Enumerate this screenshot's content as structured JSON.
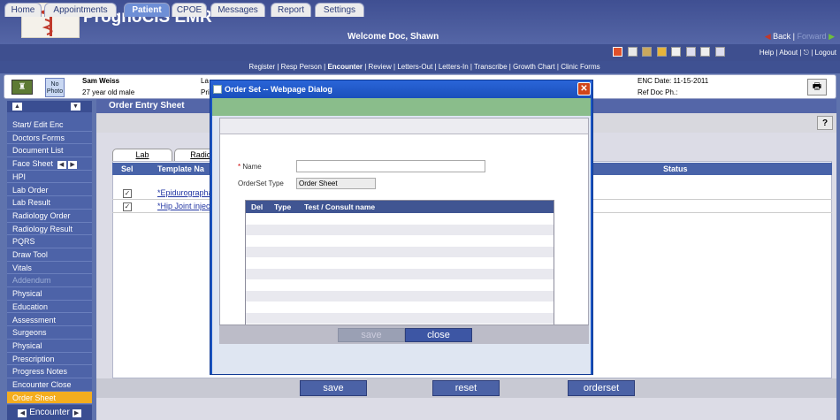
{
  "header": {
    "app_title": "PrognoCIS EMR",
    "welcome": "Welcome Doc, Shawn",
    "back": "Back |",
    "forward": "Forward"
  },
  "tabs": [
    "Home",
    "Appointments",
    "Patient",
    "CPOE",
    "Messages",
    "Report",
    "Settings"
  ],
  "active_tab": "Patient",
  "top_links": [
    "Help",
    "About",
    "Logout"
  ],
  "subnav": [
    "Register",
    "Resp Person",
    "Encounter",
    "Review",
    "Letters-Out",
    "Letters-In",
    "Transcribe",
    "Growth Chart",
    "Clinic Forms"
  ],
  "patient": {
    "photo_label": "No Photo",
    "name": "Sam Weiss",
    "age_sex": "27 year old male",
    "label_la": "La",
    "label_pri": "Pri",
    "enc_date": "ENC Date: 11-15-2011",
    "ref_doc": "Ref Doc Ph.:"
  },
  "leftnav": {
    "items": [
      "Start/ Edit Enc",
      "Doctors Forms",
      "Document List",
      "Face Sheet",
      "HPI",
      "Lab Order",
      "Lab Result",
      "Radiology Order",
      "Radiology Result",
      "PQRS",
      "Draw Tool",
      "Vitals",
      "Addendum",
      "Physical",
      "Education",
      "Assessment",
      "Surgeons",
      "Physical",
      "Prescription",
      "Progress Notes",
      "Encounter Close",
      "Order Sheet"
    ],
    "selected": "Order Sheet",
    "footer": "Encounter"
  },
  "main": {
    "title": "Order Entry Sheet",
    "help": "?",
    "subtabs": [
      "Lab",
      "Radio"
    ],
    "columns": {
      "sel": "Sel",
      "template": "Template Na",
      "status": "Status"
    },
    "rows": [
      "*Epidurographa",
      "*Hip Joint inject"
    ]
  },
  "buttons": {
    "save": "save",
    "reset": "reset",
    "orderset": "orderset"
  },
  "dialog": {
    "title": "Order Set -- Webpage Dialog",
    "name_label": "Name",
    "required_mark": "*",
    "type_label": "OrderSet Type",
    "type_value": "Order Sheet",
    "grid_columns": {
      "del": "Del",
      "type": "Type",
      "test": "Test / Consult name"
    },
    "save": "save",
    "close": "close"
  }
}
